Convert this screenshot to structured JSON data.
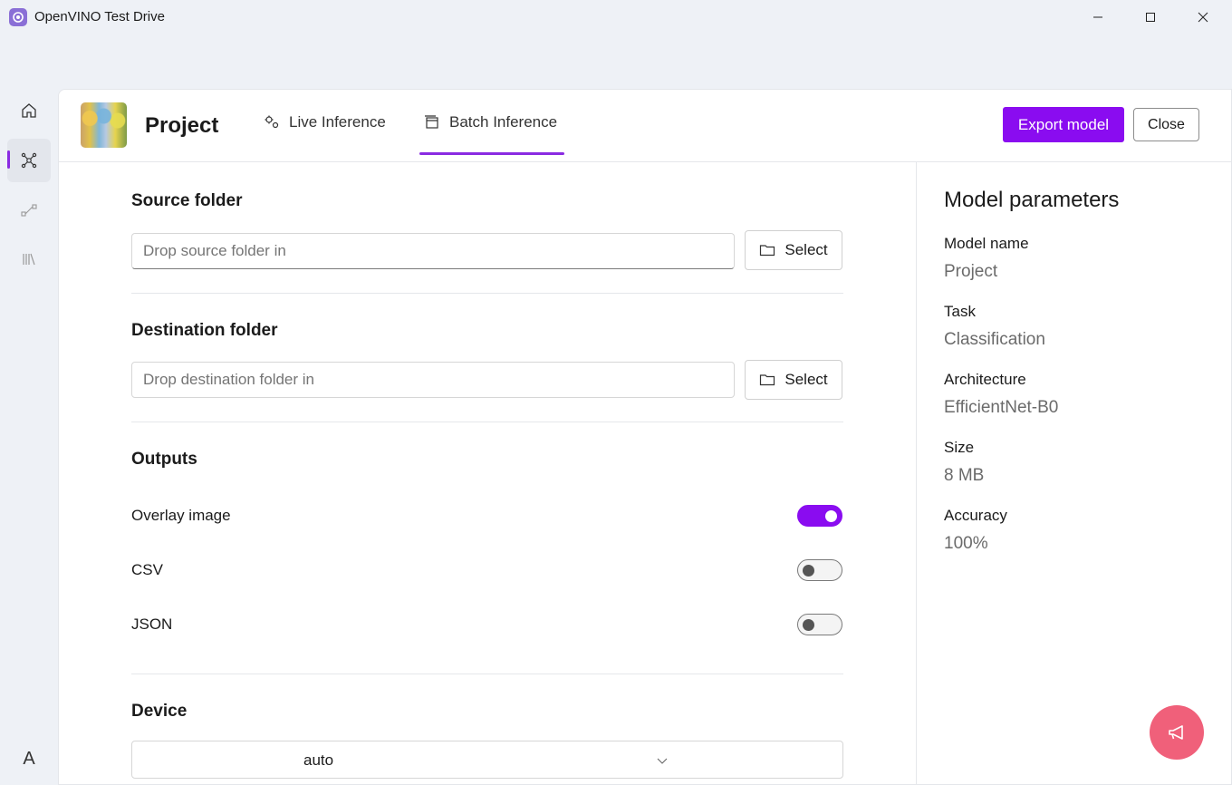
{
  "window": {
    "title": "OpenVINO Test Drive",
    "minimize_icon": "minimize-icon",
    "maximize_icon": "maximize-icon",
    "close_icon": "close-icon"
  },
  "nav": {
    "items": [
      {
        "icon": "home-icon",
        "active": false
      },
      {
        "icon": "network-icon",
        "active": true
      },
      {
        "icon": "workflow-icon",
        "active": false
      },
      {
        "icon": "library-icon",
        "active": false
      }
    ],
    "bottom_label": "A"
  },
  "header": {
    "project_title": "Project",
    "tabs": [
      {
        "label": "Live Inference",
        "icon": "gears-icon"
      },
      {
        "label": "Batch Inference",
        "icon": "batch-icon",
        "active": true
      }
    ],
    "export_label": "Export model",
    "close_label": "Close"
  },
  "source": {
    "title": "Source folder",
    "placeholder": "Drop source folder in",
    "select_label": "Select"
  },
  "destination": {
    "title": "Destination folder",
    "placeholder": "Drop destination folder in",
    "select_label": "Select"
  },
  "outputs": {
    "title": "Outputs",
    "items": [
      {
        "label": "Overlay image",
        "enabled": true
      },
      {
        "label": "CSV",
        "enabled": false
      },
      {
        "label": "JSON",
        "enabled": false
      }
    ]
  },
  "device": {
    "title": "Device",
    "value": "auto"
  },
  "params": {
    "title": "Model parameters",
    "items": [
      {
        "label": "Model name",
        "value": "Project"
      },
      {
        "label": "Task",
        "value": "Classification"
      },
      {
        "label": "Architecture",
        "value": "EfficientNet-B0"
      },
      {
        "label": "Size",
        "value": "8 MB"
      },
      {
        "label": "Accuracy",
        "value": "100%"
      }
    ]
  },
  "fab": {
    "icon": "megaphone-icon"
  },
  "colors": {
    "accent": "#8a0cf0",
    "fab": "#f0607a"
  }
}
